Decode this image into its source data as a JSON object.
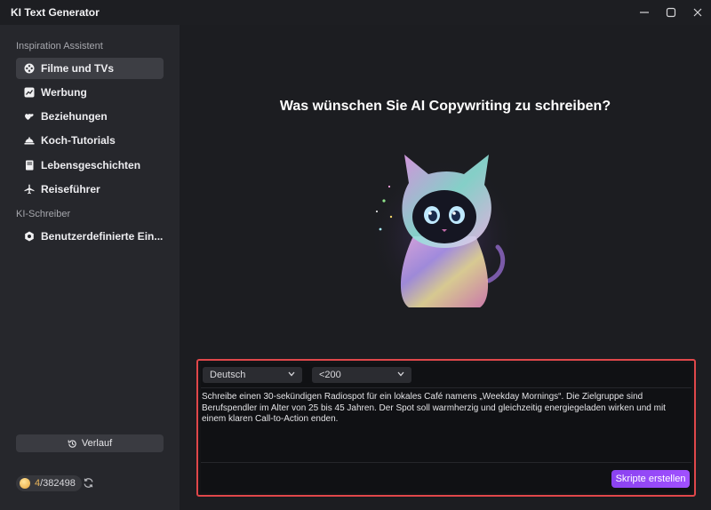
{
  "window": {
    "title": "KI Text Generator"
  },
  "sidebar": {
    "section_inspiration": "Inspiration Assistent",
    "items": [
      {
        "label": "Filme und TVs",
        "icon": "film-reel-icon",
        "active": true
      },
      {
        "label": "Werbung",
        "icon": "trend-chart-icon",
        "active": false
      },
      {
        "label": "Beziehungen",
        "icon": "hearts-icon",
        "active": false
      },
      {
        "label": "Koch-Tutorials",
        "icon": "cloche-icon",
        "active": false
      },
      {
        "label": "Lebensgeschichten",
        "icon": "book-icon",
        "active": false
      },
      {
        "label": "Reiseführer",
        "icon": "airplane-icon",
        "active": false
      }
    ],
    "section_writer": "KI-Schreiber",
    "custom_item": {
      "label": "Benutzerdefinierte Ein...",
      "icon": "gear-icon"
    },
    "history_label": "Verlauf",
    "credits": {
      "used": "4",
      "total": "/382498"
    }
  },
  "main": {
    "heading": "Was wünschen Sie AI Copywriting zu schreiben?",
    "language_select": "Deutsch",
    "length_select": "<200",
    "prompt": "Schreibe einen 30-sekündigen Radiospot für ein lokales Café namens „Weekday Mornings“. Die Zielgruppe sind Berufspendler im Alter von 25 bis 45 Jahren. Der Spot soll warmherzig und gleichzeitig energiegeladen wirken und mit einem klaren Call-to-Action enden.",
    "generate_label": "Skripte erstellen"
  },
  "colors": {
    "accent": "#9747ff",
    "highlight_border": "#e0474a",
    "coin": "#e8a53a"
  }
}
